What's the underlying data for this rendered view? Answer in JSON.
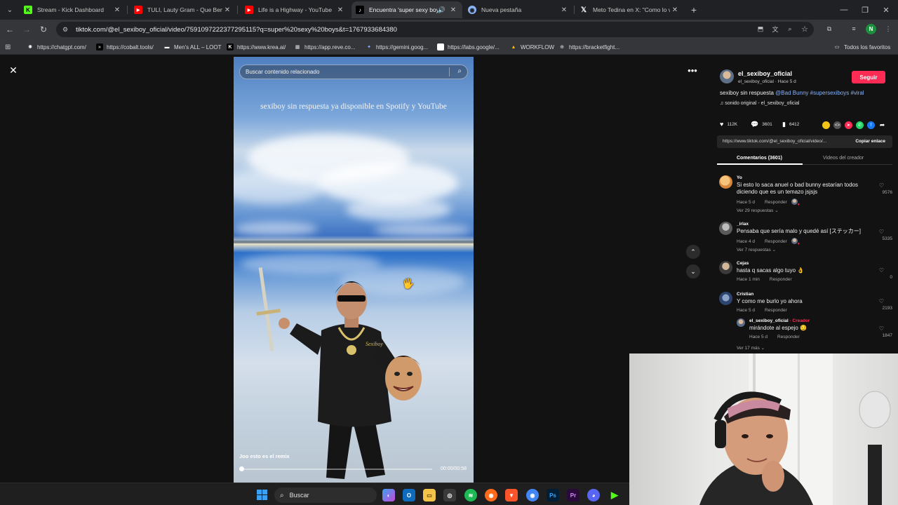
{
  "browser": {
    "tabs": [
      {
        "title": "Stream - Kick Dashboard",
        "favicon": "kick-icon",
        "color": "#53fc18",
        "active": false
      },
      {
        "title": "TULI, Lauty Gram - Que Bendici",
        "favicon": "youtube-icon",
        "color": "#ff0000",
        "active": false
      },
      {
        "title": "Life is a Highway - YouTube",
        "favicon": "youtube-icon",
        "color": "#ff0000",
        "active": false
      },
      {
        "title": "Encuentra 'super sexy boys'",
        "favicon": "tiktok-icon",
        "color": "#000000",
        "active": true
      },
      {
        "title": "Nueva pestaña",
        "favicon": "chrome-icon",
        "color": "#8ab4f8",
        "active": false
      },
      {
        "title": "Meto Tedina en X: \"Como lo vo",
        "favicon": "x-icon",
        "color": "#ffffff",
        "active": false
      }
    ],
    "url": "tiktok.com/@el_sexiboy_oficial/video/7591097222377295115?q=super%20sexy%20boys&t=1767933684380",
    "profile_initial": "N",
    "bookmarks": [
      {
        "label": "https://chatgpt.com/",
        "icon": "chatgpt-icon"
      },
      {
        "label": "https://cobalt.tools/",
        "icon": "cobalt-icon"
      },
      {
        "label": "Men's ALL – LOOT",
        "icon": "loot-icon"
      },
      {
        "label": "https://www.krea.ai/",
        "icon": "krea-icon"
      },
      {
        "label": "https://app.reve.co...",
        "icon": "reve-icon"
      },
      {
        "label": "https://gemini.goog...",
        "icon": "gemini-icon"
      },
      {
        "label": "https://labs.google/...",
        "icon": "labs-icon"
      },
      {
        "label": "WORKFLOW",
        "icon": "drive-icon"
      },
      {
        "label": "https://bracketfight...",
        "icon": "bracket-icon"
      }
    ],
    "all_bookmarks": "Todos los favoritos"
  },
  "video": {
    "search_placeholder": "Buscar contenido relacionado",
    "overlay_text": "sexiboy sin respuesta ya disponible en Spotify y YouTube",
    "caption": "Joo esto es el remix",
    "time": "00:00/00:58",
    "progress": 0.01
  },
  "post": {
    "username": "el_sexiboy_oficial",
    "sub": "el_sexiboy_oficial · Hace 5 d",
    "follow_label": "Seguir",
    "description_text": "sexiboy sin respuesta ",
    "mention": "@Bad Bunny",
    "hashtags": " #supersexiboys #viral",
    "sound": "sonido original - el_sexiboy_oficial",
    "likes": "112K",
    "comments": "3601",
    "saves": "6412",
    "link": "https://www.tiktok.com/@el_sexiboy_oficial/video/...",
    "copy_label": "Copiar enlace",
    "tab_comments": "Comentarios (3601)",
    "tab_creator": "Videos del creador"
  },
  "comments": [
    {
      "name": "Yo",
      "text": "Si esto lo saca anuel o bad bunny estarían todos diciendo que es un temazo jsjsjs",
      "time": "Hace 5 d",
      "reply": "Responder",
      "replies": "Ver 29 respuestas ⌄",
      "likes": "9576",
      "avatar_color": "#e8a15a",
      "creator_liked": true
    },
    {
      "name": "_irlax",
      "text": "Pensaba que sería malo y quedé así [ステッカー]",
      "time": "Hace 4 d",
      "reply": "Responder",
      "replies": "Ver 7 respuestas ⌄",
      "likes": "5335",
      "avatar_color": "#8a8a8a",
      "creator_liked": true
    },
    {
      "name": "Cejas",
      "text": "hasta q sacas algo tuyo 👌",
      "time": "Hace 1 min",
      "reply": "Responder",
      "replies": "",
      "likes": "0",
      "avatar_color": "#6f6f6f",
      "creator_liked": false
    },
    {
      "name": "Cristian",
      "text": "Y como me burlo yo ahora",
      "time": "Hace 5 d",
      "reply": "Responder",
      "replies": "",
      "likes": "2193",
      "avatar_color": "#3d5a8a",
      "creator_liked": false
    }
  ],
  "reply": {
    "name": "el_sexiboy_oficial",
    "creator_tag": " · Creador",
    "text": "mirándote al espejo 😏",
    "time": "Hace 5 d",
    "reply": "Responder",
    "likes": "1847"
  },
  "more_replies": "Ver 17 más ⌄",
  "taskbar": {
    "search_label": "Buscar"
  }
}
